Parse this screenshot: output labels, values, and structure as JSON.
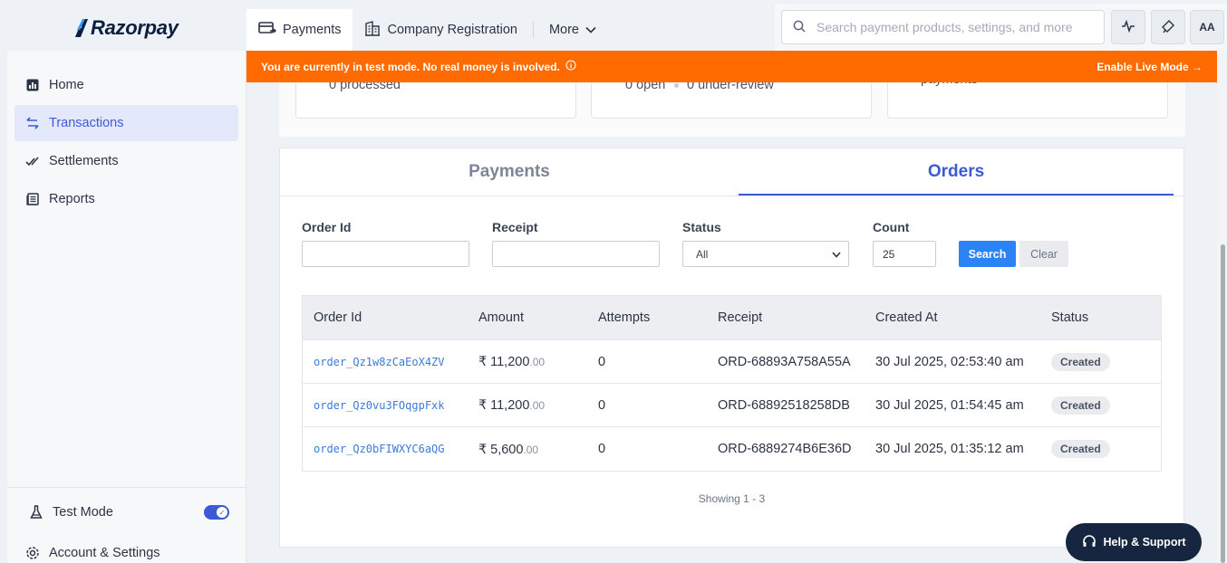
{
  "brand": {
    "name": "Razorpay"
  },
  "sidebar": {
    "items": [
      {
        "label": "Home",
        "icon": "chart-icon"
      },
      {
        "label": "Transactions",
        "icon": "arrows-icon",
        "active": true
      },
      {
        "label": "Settlements",
        "icon": "double-check-icon"
      },
      {
        "label": "Reports",
        "icon": "document-icon"
      }
    ],
    "test_mode_label": "Test Mode",
    "test_mode_on": true,
    "account_label": "Account & Settings"
  },
  "topnav": {
    "tabs": [
      {
        "label": "Payments",
        "active": true
      },
      {
        "label": "Company Registration"
      },
      {
        "label": "More"
      }
    ],
    "search_placeholder": "Search payment products, settings, and more",
    "avatar_initials": "AA"
  },
  "banner": {
    "message": "You are currently in test mode. No real money is involved.",
    "action": "Enable Live Mode →",
    "color": "#ff6b00"
  },
  "summary": {
    "card1": "0 processed",
    "card2_open": "0 open",
    "card2_review": "0 under-review",
    "card3": "payments"
  },
  "panel_tabs": [
    {
      "label": "Payments"
    },
    {
      "label": "Orders",
      "active": true
    }
  ],
  "filters": {
    "order_id_label": "Order Id",
    "receipt_label": "Receipt",
    "status_label": "Status",
    "status_value": "All",
    "count_label": "Count",
    "count_value": "25",
    "search_button": "Search",
    "clear_button": "Clear"
  },
  "table": {
    "headers": [
      "Order Id",
      "Amount",
      "Attempts",
      "Receipt",
      "Created At",
      "Status"
    ],
    "rows": [
      {
        "order_id": "order_Qz1w8zCaEoX4ZV",
        "currency": "₹",
        "amount": "11,200",
        "decimals": ".00",
        "attempts": "0",
        "receipt": "ORD-68893A758A55A",
        "created_at": "30 Jul 2025, 02:53:40 am",
        "status": "Created"
      },
      {
        "order_id": "order_Qz0vu3FOqgpFxk",
        "currency": "₹",
        "amount": "11,200",
        "decimals": ".00",
        "attempts": "0",
        "receipt": "ORD-68892518258DB",
        "created_at": "30 Jul 2025, 01:54:45 am",
        "status": "Created"
      },
      {
        "order_id": "order_Qz0bFIWXYC6aQG",
        "currency": "₹",
        "amount": "5,600",
        "decimals": ".00",
        "attempts": "0",
        "receipt": "ORD-6889274B6E36D",
        "created_at": "30 Jul 2025, 01:35:12 am",
        "status": "Created"
      }
    ],
    "showing": "Showing 1 - 3"
  },
  "help": {
    "label": "Help & Support"
  },
  "colors": {
    "accent": "#3d5ad6",
    "search_button": "#2b83f6",
    "link": "#3b7bd9"
  }
}
